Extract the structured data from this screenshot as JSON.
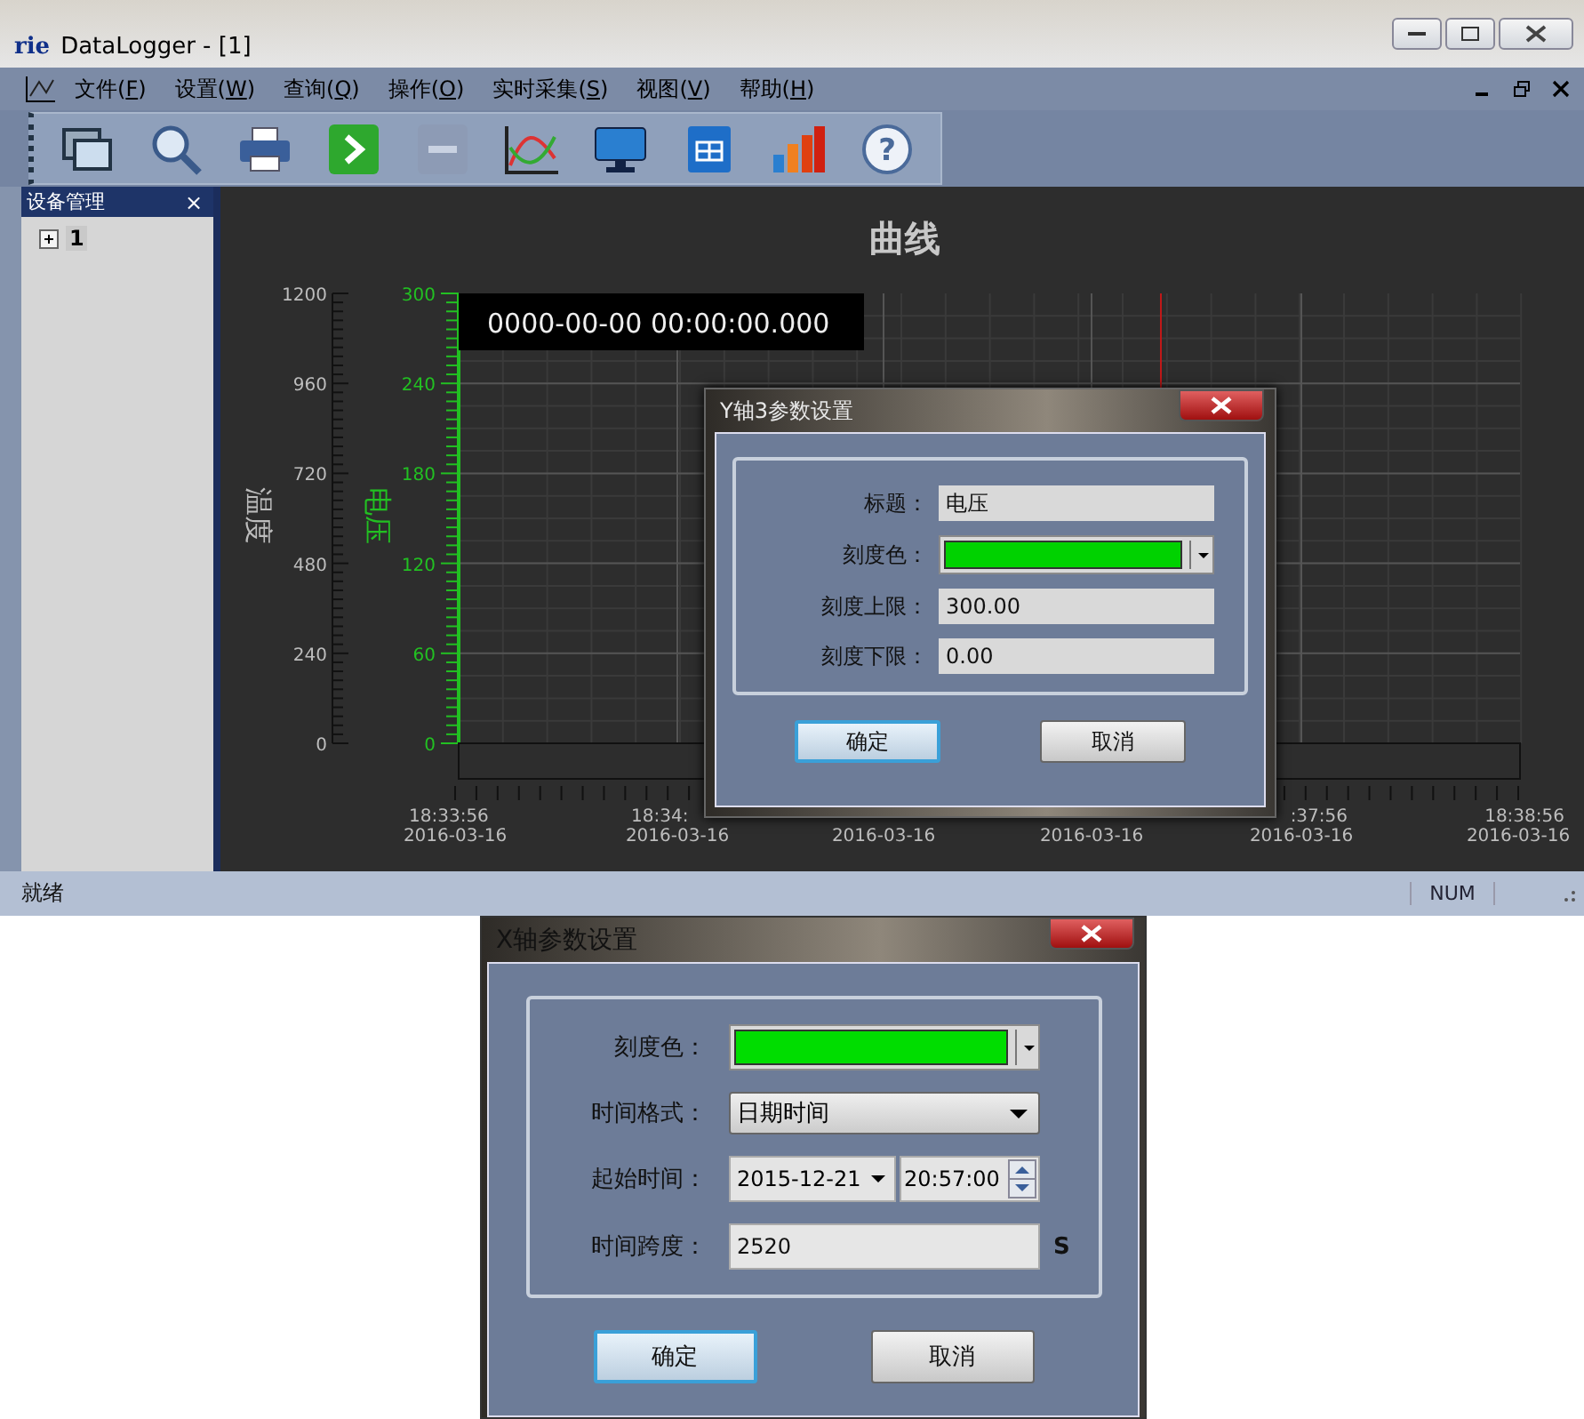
{
  "window": {
    "logo": "rie",
    "title": "DataLogger - [1]"
  },
  "menu": [
    {
      "before": "文件(",
      "key": "F",
      "after": ")"
    },
    {
      "before": "设置(",
      "key": "W",
      "after": ")"
    },
    {
      "before": "查询(",
      "key": "Q",
      "after": ")"
    },
    {
      "before": "操作(",
      "key": "O",
      "after": ")"
    },
    {
      "before": "实时采集(",
      "key": "S",
      "after": ")"
    },
    {
      "before": "视图(",
      "key": "V",
      "after": ")"
    },
    {
      "before": "帮助(",
      "key": "H",
      "after": ")"
    }
  ],
  "toolbar": {
    "help_glyph": "?"
  },
  "sidebar": {
    "title": "设备管理",
    "close": "×",
    "tree": [
      {
        "label": "1",
        "expanded": false
      }
    ]
  },
  "chart": {
    "title": "曲线",
    "timestamp": "0000-00-00 00:00:00.000",
    "y_axis_1": {
      "title": "温度",
      "ticks": [
        "1200",
        "960",
        "720",
        "480",
        "240",
        "0"
      ]
    },
    "y_axis_2": {
      "title": "电压",
      "ticks": [
        "300",
        "240",
        "180",
        "120",
        "60",
        "0"
      ]
    },
    "x_labels": [
      {
        "time": "18:33:56",
        "date": "2016-03-16"
      },
      {
        "time": "18:34:",
        "date": "2016-03-16"
      },
      {
        "date": "2016-03-16"
      },
      {
        "date": "2016-03-16"
      },
      {
        "time": ":37:56",
        "date": "2016-03-16"
      },
      {
        "time": "18:38:56",
        "date": "2016-03-16"
      }
    ]
  },
  "status_bar": {
    "text": "就绪",
    "indicator": "NUM"
  },
  "dialog_y": {
    "title": "Y轴3参数设置",
    "rows": [
      {
        "kind": "text",
        "label": "标题：",
        "value": "电压"
      },
      {
        "kind": "color",
        "label": "刻度色：",
        "color": "#00d200"
      },
      {
        "kind": "text",
        "label": "刻度上限：",
        "value": "300.00"
      },
      {
        "kind": "text",
        "label": "刻度下限：",
        "value": "0.00"
      }
    ],
    "buttons": [
      {
        "label": "确定",
        "default": true
      },
      {
        "label": "取消",
        "default": false
      }
    ]
  },
  "dialog_x": {
    "title": "X轴参数设置",
    "rows": [
      {
        "kind": "color",
        "label": "刻度色：",
        "color": "#00dd00"
      },
      {
        "kind": "select",
        "label": "时间格式：",
        "value": "日期时间"
      },
      {
        "kind": "datetime",
        "label": "起始时间：",
        "date": "2015-12-21",
        "time": "20:57:00"
      },
      {
        "kind": "text",
        "label": "时间跨度：",
        "value": "2520",
        "unit": "S"
      }
    ],
    "buttons": [
      {
        "label": "确定",
        "default": true
      },
      {
        "label": "取消",
        "default": false
      }
    ]
  }
}
